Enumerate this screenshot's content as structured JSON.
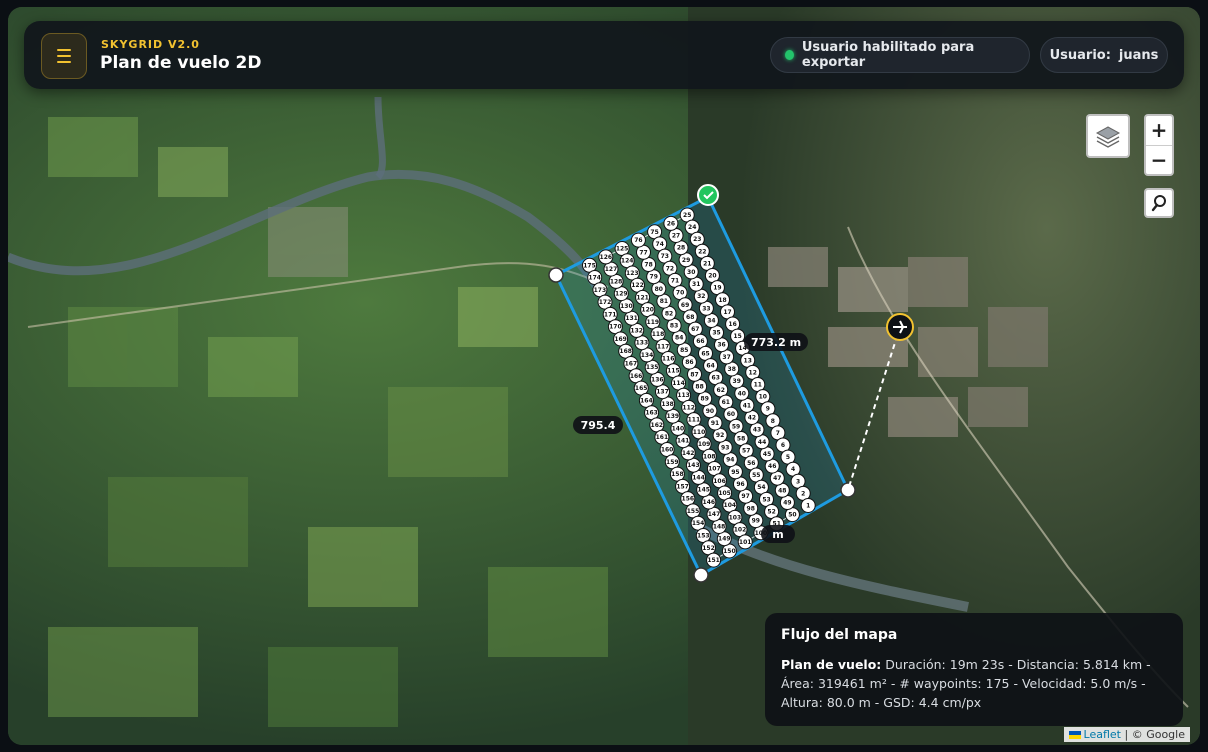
{
  "header": {
    "brand": "SKYGRID V2.0",
    "title": "Plan de vuelo 2D",
    "export_status": "Usuario habilitado para exportar",
    "user_label": "Usuario:",
    "user_name": "juans"
  },
  "map_controls": {
    "zoom_in": "+",
    "zoom_out": "−",
    "layers_icon": "layers-icon",
    "search_icon": "search-icon"
  },
  "distances": [
    "773.2 m",
    "795.4",
    "m"
  ],
  "info_panel": {
    "title": "Flujo del mapa",
    "plan_label": "Plan de vuelo:",
    "duracion": "Duración: 19m 23s",
    "distancia": "Distancia: 5.814 km",
    "area": "Área: 319461 m²",
    "waypoints": "# waypoints: 175",
    "velocidad": "Velocidad: 5.0 m/s",
    "altura": "Altura: 80.0 m",
    "gsd": "GSD: 4.4 cm/px",
    "separator": " - "
  },
  "attribution": {
    "leaflet": "Leaflet",
    "separator": " | © ",
    "google": "Google"
  },
  "flight": {
    "waypoint_count": 175,
    "columns": 7,
    "colors": {
      "polygon": "#1e9be0",
      "start": "#22c55e",
      "home": "#f2c230",
      "bg": "#0e1116"
    }
  }
}
